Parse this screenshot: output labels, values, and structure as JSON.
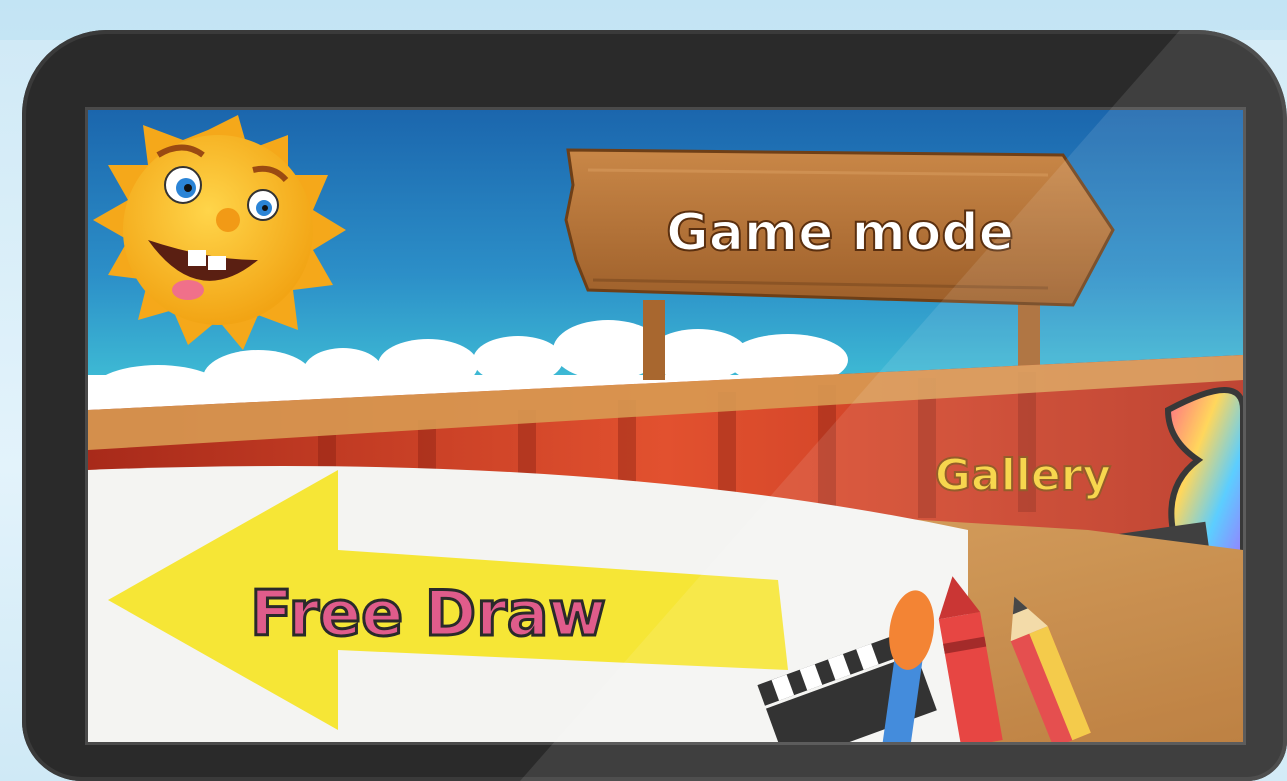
{
  "menu": {
    "game_mode_label": "Game mode",
    "gallery_label": "Gallery",
    "free_draw_label": "Free Draw"
  },
  "colors": {
    "sky_top": "#1d6fb6",
    "sky_bottom": "#3ec3d6",
    "curtain": "#d8432a",
    "paper": "#f4f4f2",
    "wood": "#c98a3e",
    "sign": "#b8773a",
    "sun": "#f7b820",
    "arrow": "#f6e52b",
    "gallery_text": "#f7d23a"
  },
  "icons": [
    "sun-character-icon",
    "signpost-icon",
    "film-strip-icon",
    "clapperboard-icon",
    "paintbrush-icon",
    "crayon-icon",
    "pencil-icon",
    "arrow-icon"
  ]
}
